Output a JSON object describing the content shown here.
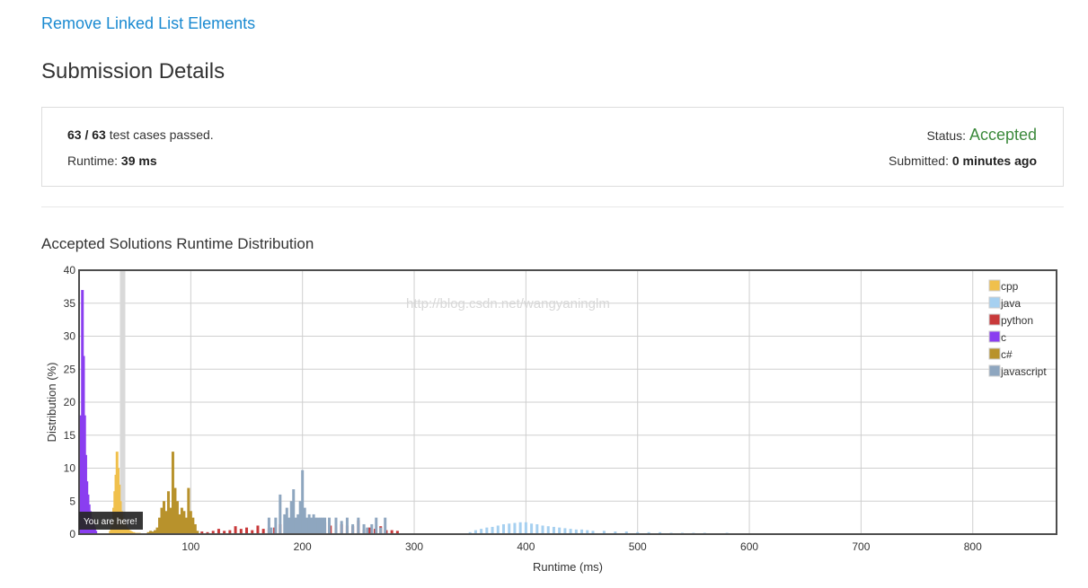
{
  "problem": {
    "title": "Remove Linked List Elements"
  },
  "page": {
    "title": "Submission Details"
  },
  "details": {
    "passed": "63 / 63",
    "passed_suffix": " test cases passed.",
    "runtime_label": "Runtime: ",
    "runtime_value": "39 ms",
    "status_label": "Status: ",
    "status_value": "Accepted",
    "submitted_label": "Submitted: ",
    "submitted_value": "0 minutes ago"
  },
  "chart": {
    "title": "Accepted Solutions Runtime Distribution",
    "watermark": "http://blog.csdn.net/wangyaninglm",
    "you_are_here": "You are here!"
  },
  "colors": {
    "cpp": "#f0c04c",
    "java": "#a6d0f0",
    "python": "#c8393a",
    "c": "#8a3ef0",
    "csharp": "#b8922c",
    "javascript": "#8ea6bf",
    "highlight": "#d9d9d9"
  },
  "chart_data": {
    "type": "bar",
    "xlabel": "Runtime (ms)",
    "ylabel": "Distribution (%)",
    "xlim": [
      0,
      875
    ],
    "ylim": [
      0,
      40
    ],
    "x_ticks": [
      100,
      200,
      300,
      400,
      500,
      600,
      700,
      800
    ],
    "y_ticks": [
      0,
      5,
      10,
      15,
      20,
      25,
      30,
      35,
      40
    ],
    "grid": true,
    "legend": "top-right",
    "highlight_x": 39,
    "series": [
      {
        "name": "cpp",
        "x": [
          28,
          29,
          30,
          31,
          32,
          33,
          34,
          35,
          36,
          37,
          38,
          39,
          40,
          41,
          42,
          43,
          44,
          45,
          46,
          47,
          48,
          49,
          50,
          52,
          54,
          56,
          58,
          60
        ],
        "values": [
          0.5,
          1.0,
          2.0,
          4.0,
          6.5,
          9.0,
          12.5,
          10.0,
          7.5,
          5.0,
          3.5,
          2.5,
          2.0,
          1.5,
          1.2,
          1.0,
          0.8,
          0.6,
          0.5,
          0.4,
          0.3,
          0.3,
          0.2,
          0.2,
          0.2,
          0.1,
          0.1,
          0.1
        ]
      },
      {
        "name": "java",
        "x": [
          350,
          355,
          360,
          365,
          370,
          375,
          380,
          385,
          390,
          395,
          400,
          405,
          410,
          415,
          420,
          425,
          430,
          435,
          440,
          445,
          450,
          455,
          460,
          470,
          480,
          490,
          500,
          510,
          520,
          530,
          540,
          550,
          560,
          580,
          600,
          620,
          640,
          660,
          690,
          720,
          760,
          800,
          840
        ],
        "values": [
          0.3,
          0.6,
          0.8,
          1.0,
          1.1,
          1.3,
          1.5,
          1.6,
          1.7,
          1.8,
          1.8,
          1.6,
          1.5,
          1.3,
          1.2,
          1.1,
          1.0,
          0.9,
          0.8,
          0.7,
          0.7,
          0.6,
          0.5,
          0.5,
          0.4,
          0.4,
          0.3,
          0.3,
          0.3,
          0.2,
          0.2,
          0.2,
          0.2,
          0.2,
          0.1,
          0.1,
          0.1,
          0.1,
          0.1,
          0.1,
          0.1,
          0.1,
          0.1
        ]
      },
      {
        "name": "python",
        "x": [
          110,
          115,
          120,
          125,
          130,
          135,
          140,
          145,
          150,
          155,
          160,
          165,
          170,
          175,
          180,
          185,
          190,
          195,
          200,
          205,
          210,
          215,
          220,
          225,
          230,
          235,
          240,
          245,
          250,
          255,
          260,
          265,
          270,
          275,
          280,
          285
        ],
        "values": [
          0.4,
          0.3,
          0.5,
          0.8,
          0.5,
          0.6,
          1.2,
          0.8,
          1.0,
          0.6,
          1.3,
          0.8,
          0.9,
          1.0,
          1.5,
          1.2,
          1.2,
          1.0,
          2.2,
          1.5,
          1.5,
          1.2,
          1.8,
          1.3,
          1.0,
          1.5,
          1.3,
          1.2,
          2.1,
          0.7,
          1.0,
          0.8,
          1.2,
          0.6,
          0.6,
          0.5
        ]
      },
      {
        "name": "c",
        "x": [
          1,
          2,
          3,
          4,
          5,
          6,
          7,
          8,
          9,
          10,
          11,
          12,
          13,
          14,
          15
        ],
        "values": [
          3.0,
          18.0,
          37.0,
          27.0,
          18.0,
          12.0,
          8.0,
          6.0,
          4.5,
          3.5,
          2.5,
          2.0,
          1.5,
          1.0,
          0.5
        ]
      },
      {
        "name": "c#",
        "x": [
          62,
          64,
          66,
          68,
          70,
          72,
          74,
          76,
          78,
          80,
          82,
          84,
          86,
          88,
          90,
          92,
          94,
          96,
          98,
          100,
          102,
          104,
          106
        ],
        "values": [
          0.3,
          0.5,
          0.4,
          0.6,
          1.0,
          2.5,
          4.0,
          5.0,
          3.5,
          6.5,
          4.0,
          12.5,
          7.0,
          5.0,
          3.0,
          4.0,
          3.5,
          2.5,
          7.0,
          3.5,
          2.5,
          1.5,
          0.5
        ]
      },
      {
        "name": "javascript",
        "x": [
          170,
          172,
          176,
          180,
          184,
          186,
          188,
          190,
          192,
          194,
          196,
          198,
          200,
          202,
          204,
          206,
          208,
          210,
          212,
          214,
          216,
          218,
          220,
          224,
          230,
          235,
          240,
          245,
          250,
          255,
          258,
          262,
          266,
          270,
          274
        ],
        "values": [
          2.5,
          1.0,
          2.5,
          6.0,
          3.0,
          4.0,
          2.5,
          5.0,
          6.8,
          2.5,
          3.0,
          5.0,
          9.7,
          4.0,
          2.5,
          3.0,
          2.5,
          3.0,
          2.5,
          2.5,
          2.5,
          2.5,
          2.5,
          2.5,
          2.5,
          2.0,
          2.5,
          1.5,
          2.5,
          1.5,
          1.0,
          1.5,
          2.5,
          1.0,
          2.5
        ]
      }
    ]
  }
}
